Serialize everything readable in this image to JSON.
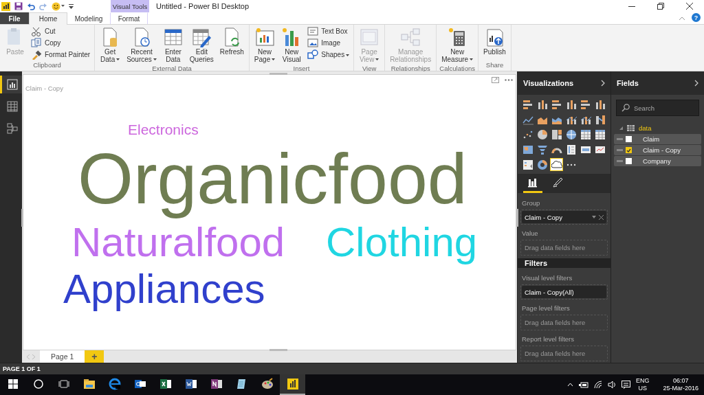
{
  "title_bar": {
    "contextual_group": "Visual Tools",
    "title": "Untitled - Power BI Desktop",
    "help": "?"
  },
  "ribbon_tabs": [
    {
      "label": "File",
      "kind": "file",
      "selected": false
    },
    {
      "label": "Home",
      "kind": "tab",
      "selected": true
    },
    {
      "label": "Modeling",
      "kind": "tab",
      "selected": false
    },
    {
      "label": "Format",
      "kind": "contextual",
      "selected": false
    }
  ],
  "ribbon_groups": [
    {
      "label": "Clipboard",
      "buttons": [
        {
          "label": "Paste",
          "kind": "large",
          "disabled": true,
          "dropdown": false
        },
        {
          "label": "Cut",
          "kind": "small",
          "disabled": false,
          "dropdown": false
        },
        {
          "label": "Copy",
          "kind": "small",
          "disabled": false,
          "dropdown": false
        },
        {
          "label": "Format Painter",
          "kind": "small",
          "disabled": false,
          "dropdown": false
        }
      ]
    },
    {
      "label": "External Data",
      "buttons": [
        {
          "label": "Get Data",
          "kind": "large",
          "disabled": false,
          "dropdown": true
        },
        {
          "label": "Recent Sources",
          "kind": "large",
          "disabled": false,
          "dropdown": true
        },
        {
          "label": "Enter Data",
          "kind": "large",
          "disabled": false,
          "dropdown": false
        },
        {
          "label": "Edit Queries",
          "kind": "large",
          "disabled": false,
          "dropdown": false
        },
        {
          "label": "Refresh",
          "kind": "large",
          "disabled": false,
          "dropdown": false
        }
      ]
    },
    {
      "label": "Insert",
      "buttons": [
        {
          "label": "New Page",
          "kind": "large",
          "disabled": false,
          "dropdown": true
        },
        {
          "label": "New Visual",
          "kind": "large",
          "disabled": false,
          "dropdown": false
        },
        {
          "label": "Text Box",
          "kind": "small",
          "disabled": false,
          "dropdown": false
        },
        {
          "label": "Image",
          "kind": "small",
          "disabled": false,
          "dropdown": false
        },
        {
          "label": "Shapes",
          "kind": "small",
          "disabled": false,
          "dropdown": true
        }
      ]
    },
    {
      "label": "View",
      "buttons": [
        {
          "label": "Page View",
          "kind": "large",
          "disabled": true,
          "dropdown": true
        }
      ]
    },
    {
      "label": "Relationships",
      "buttons": [
        {
          "label": "Manage Relationships",
          "kind": "large",
          "disabled": true,
          "dropdown": false
        }
      ]
    },
    {
      "label": "Calculations",
      "buttons": [
        {
          "label": "New Measure",
          "kind": "large",
          "disabled": false,
          "dropdown": true
        }
      ]
    },
    {
      "label": "Share",
      "buttons": [
        {
          "label": "Publish",
          "kind": "large",
          "disabled": false,
          "dropdown": false
        }
      ]
    }
  ],
  "nav_items": [
    {
      "selected": true
    },
    {
      "selected": false
    },
    {
      "selected": false
    }
  ],
  "visual": {
    "title": "Claim - Copy",
    "words": [
      {
        "text": "Electronics",
        "color": "#cc66dd"
      },
      {
        "text": "Organicfood",
        "color": "#6f7d52"
      },
      {
        "text": "Naturalfood",
        "color": "#c070ee"
      },
      {
        "text": "Clothing",
        "color": "#20d6e2"
      },
      {
        "text": "Appliances",
        "color": "#3040cc"
      }
    ]
  },
  "page_tabs": [
    {
      "label": "Page 1",
      "selected": true
    }
  ],
  "add_page": "+",
  "visualizations": {
    "title": "Visualizations",
    "visual_types": [
      {
        "selected": false
      },
      {
        "selected": false
      },
      {
        "selected": false
      },
      {
        "selected": false
      },
      {
        "selected": false
      },
      {
        "selected": false
      },
      {
        "selected": false
      },
      {
        "selected": false
      },
      {
        "selected": false
      },
      {
        "selected": false
      },
      {
        "selected": false
      },
      {
        "selected": false
      },
      {
        "selected": false
      },
      {
        "selected": false
      },
      {
        "selected": false
      },
      {
        "selected": false
      },
      {
        "selected": false
      },
      {
        "selected": false
      },
      {
        "selected": false
      },
      {
        "selected": false
      },
      {
        "selected": false
      },
      {
        "selected": false
      },
      {
        "selected": false
      },
      {
        "selected": false
      },
      {
        "selected": false
      },
      {
        "selected": false
      },
      {
        "selected": true
      }
    ],
    "pane_tabs": [
      {
        "selected": true
      },
      {
        "selected": false
      }
    ],
    "wells": [
      {
        "label": "Group",
        "value": "Claim - Copy"
      },
      {
        "label": "Value",
        "placeholder": "Drag data fields here"
      }
    ]
  },
  "filters": {
    "title": "Filters",
    "sections": [
      {
        "label": "Visual level filters",
        "value": "Claim - Copy(All)"
      },
      {
        "label": "Page level filters",
        "placeholder": "Drag data fields here"
      },
      {
        "label": "Report level filters",
        "placeholder": "Drag data fields here"
      }
    ]
  },
  "fields": {
    "title": "Fields",
    "search": {
      "placeholder": "Search"
    },
    "tables": [
      {
        "name": "data",
        "expanded": true,
        "fields": [
          {
            "name": "Claim",
            "checked": false
          },
          {
            "name": "Claim - Copy",
            "checked": true
          },
          {
            "name": "Company",
            "checked": false
          }
        ]
      }
    ]
  },
  "status_bar": "PAGE 1 OF 1",
  "taskbar": {
    "apps": [
      {
        "active": false
      },
      {
        "active": false
      },
      {
        "active": false
      },
      {
        "active": false
      },
      {
        "active": false
      },
      {
        "active": false
      },
      {
        "active": false
      },
      {
        "active": false
      },
      {
        "active": true
      }
    ],
    "language": "ENG",
    "region": "US",
    "time": "06:07",
    "date": "25-Mar-2016"
  }
}
